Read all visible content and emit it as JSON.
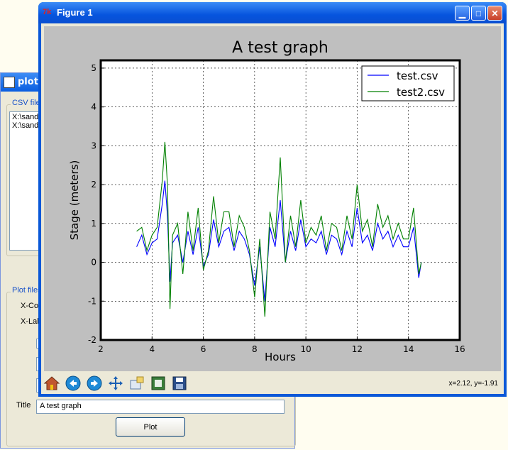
{
  "background_window": {
    "title": "plotc",
    "csv_group_label": "CSV files",
    "csv_files": [
      "X:\\sand",
      "X:\\sand"
    ],
    "plot_group_label": "Plot files",
    "x_col_label": "X-Col",
    "x_label_label": "X-Lab",
    "title_label": "Title",
    "title_value": "A test graph",
    "plot_button": "Plot"
  },
  "figure_window": {
    "title": "Figure 1",
    "coords_readout": "x=2.12, y=-1.91"
  },
  "toolbar": {
    "icons": [
      "home-icon",
      "back-arrow-icon",
      "forward-arrow-icon",
      "pan-icon",
      "zoom-icon",
      "subplots-icon",
      "save-icon"
    ]
  },
  "chart_data": {
    "type": "line",
    "title": "A test graph",
    "xlabel": "Hours",
    "ylabel": "Stage (meters)",
    "xlim": [
      2,
      16
    ],
    "ylim": [
      -2,
      5.2
    ],
    "xticks": [
      2,
      4,
      6,
      8,
      10,
      12,
      14,
      16
    ],
    "yticks": [
      -2,
      -1,
      0,
      1,
      2,
      3,
      4,
      5
    ],
    "grid": true,
    "legend": "top-right",
    "x": [
      3.4,
      3.6,
      3.8,
      4.0,
      4.2,
      4.4,
      4.5,
      4.6,
      4.7,
      4.8,
      5.0,
      5.2,
      5.4,
      5.6,
      5.8,
      6.0,
      6.2,
      6.4,
      6.6,
      6.8,
      7.0,
      7.2,
      7.4,
      7.6,
      7.8,
      8.0,
      8.2,
      8.4,
      8.6,
      8.8,
      9.0,
      9.2,
      9.4,
      9.6,
      9.8,
      10.0,
      10.2,
      10.4,
      10.6,
      10.8,
      11.0,
      11.2,
      11.4,
      11.6,
      11.8,
      12.0,
      12.2,
      12.4,
      12.6,
      12.8,
      13.0,
      13.2,
      13.4,
      13.6,
      13.8,
      14.0,
      14.2,
      14.4,
      14.5
    ],
    "series": [
      {
        "name": "test.csv",
        "color": "#0000ff",
        "values": [
          0.4,
          0.7,
          0.2,
          0.5,
          0.6,
          1.5,
          2.1,
          1.2,
          -0.5,
          0.5,
          0.7,
          0.0,
          0.8,
          0.2,
          0.9,
          -0.1,
          0.2,
          1.1,
          0.4,
          0.8,
          0.9,
          0.3,
          0.8,
          0.6,
          0.2,
          -0.6,
          0.4,
          -1.0,
          0.9,
          0.4,
          1.6,
          0.0,
          0.8,
          0.3,
          1.1,
          0.4,
          0.6,
          0.5,
          0.8,
          0.2,
          0.7,
          0.6,
          0.2,
          0.8,
          0.4,
          1.4,
          0.5,
          0.7,
          0.3,
          1.0,
          0.6,
          0.8,
          0.4,
          0.7,
          0.4,
          0.4,
          0.9,
          -0.4,
          0.0
        ]
      },
      {
        "name": "test2.csv",
        "color": "#008000",
        "values": [
          0.8,
          0.9,
          0.3,
          0.7,
          0.9,
          2.1,
          3.1,
          2.0,
          -1.2,
          0.7,
          1.0,
          -0.3,
          1.3,
          0.3,
          1.4,
          -0.2,
          0.3,
          1.7,
          0.5,
          1.3,
          1.3,
          0.4,
          1.2,
          0.9,
          0.3,
          -0.9,
          0.6,
          -1.4,
          1.3,
          0.6,
          2.7,
          0.0,
          1.2,
          0.4,
          1.6,
          0.5,
          0.9,
          0.7,
          1.2,
          0.3,
          1.0,
          0.9,
          0.3,
          1.2,
          0.6,
          2.0,
          0.8,
          1.1,
          0.4,
          1.5,
          0.9,
          1.2,
          0.6,
          1.0,
          0.6,
          0.6,
          1.4,
          -0.3,
          0.0
        ]
      }
    ]
  }
}
